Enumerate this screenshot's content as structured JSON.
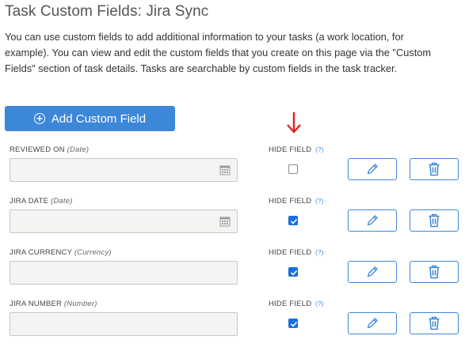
{
  "page": {
    "title": "Task Custom Fields: Jira Sync",
    "description": "You can use custom fields to add additional information to your tasks (a work location, for example). You can view and edit the custom fields that you create on this page via the \"Custom Fields\" section of task details. Tasks are searchable by custom fields in the task tracker."
  },
  "add_button": {
    "label": "Add Custom Field",
    "icon": "plus-circle-icon"
  },
  "hide_field": {
    "label": "HIDE FIELD",
    "help": "(?)"
  },
  "colors": {
    "accent": "#3d87d8",
    "arrow": "#e02020",
    "checkbox": "#1a6fe0"
  },
  "fields": [
    {
      "name": "REVIEWED ON",
      "type": "(Date)",
      "value": "",
      "date_picker": true,
      "hidden": false
    },
    {
      "name": "JIRA DATE",
      "type": "(Date)",
      "value": "",
      "date_picker": true,
      "hidden": true
    },
    {
      "name": "JIRA CURRENCY",
      "type": "(Currency)",
      "value": "",
      "date_picker": false,
      "hidden": true
    },
    {
      "name": "JIRA NUMBER",
      "type": "(Number)",
      "value": "",
      "date_picker": false,
      "hidden": true
    }
  ]
}
